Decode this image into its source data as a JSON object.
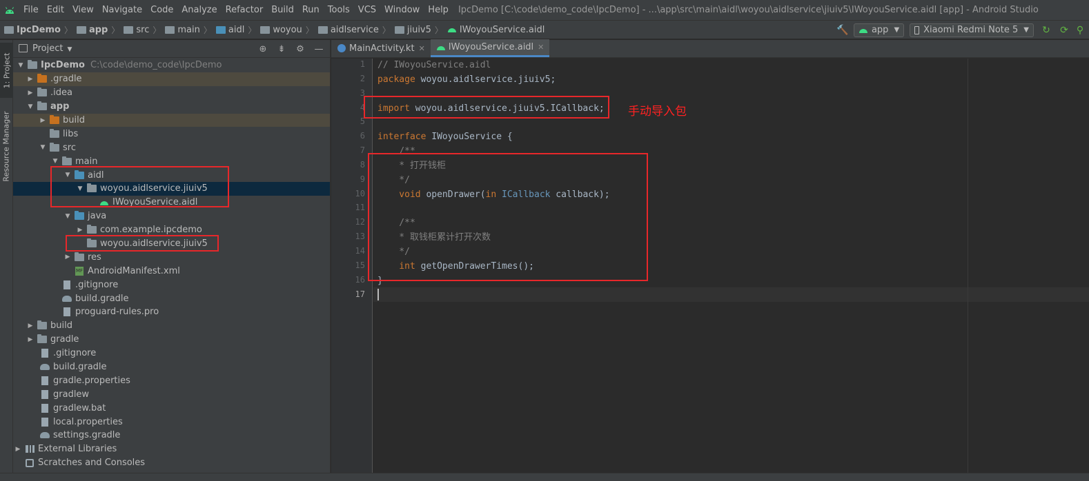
{
  "menu": {
    "items": [
      "File",
      "Edit",
      "View",
      "Navigate",
      "Code",
      "Analyze",
      "Refactor",
      "Build",
      "Run",
      "Tools",
      "VCS",
      "Window",
      "Help"
    ],
    "window_title": "IpcDemo [C:\\code\\demo_code\\IpcDemo] - ...\\app\\src\\main\\aidl\\woyou\\aidlservice\\jiuiv5\\IWoyouService.aidl [app] - Android Studio"
  },
  "breadcrumb": [
    "IpcDemo",
    "app",
    "src",
    "main",
    "aidl",
    "woyou",
    "aidlservice",
    "jiuiv5",
    "IWoyouService.aidl"
  ],
  "toolbar": {
    "run_config": "app",
    "device": "Xiaomi Redmi Note 5"
  },
  "side_stripe": {
    "project_tab": "1: Project",
    "resource_tab": "Resource Manager"
  },
  "project_panel": {
    "title": "Project",
    "tree": [
      {
        "label": "IpcDemo",
        "hint": "C:\\code\\demo_code\\IpcDemo"
      },
      {
        "label": ".gradle"
      },
      {
        "label": ".idea"
      },
      {
        "label": "app"
      },
      {
        "label": "build"
      },
      {
        "label": "libs"
      },
      {
        "label": "src"
      },
      {
        "label": "main"
      },
      {
        "label": "aidl"
      },
      {
        "label": "woyou.aidlservice.jiuiv5"
      },
      {
        "label": "IWoyouService.aidl"
      },
      {
        "label": "java"
      },
      {
        "label": "com.example.ipcdemo"
      },
      {
        "label": "woyou.aidlservice.jiuiv5"
      },
      {
        "label": "res"
      },
      {
        "label": "AndroidManifest.xml"
      },
      {
        "label": ".gitignore"
      },
      {
        "label": "build.gradle"
      },
      {
        "label": "proguard-rules.pro"
      },
      {
        "label": "build"
      },
      {
        "label": "gradle"
      },
      {
        "label": ".gitignore"
      },
      {
        "label": "build.gradle"
      },
      {
        "label": "gradle.properties"
      },
      {
        "label": "gradlew"
      },
      {
        "label": "gradlew.bat"
      },
      {
        "label": "local.properties"
      },
      {
        "label": "settings.gradle"
      },
      {
        "label": "External Libraries"
      },
      {
        "label": "Scratches and Consoles"
      }
    ]
  },
  "editor": {
    "tabs": [
      {
        "label": "MainActivity.kt"
      },
      {
        "label": "IWoyouService.aidl"
      }
    ],
    "line_numbers": [
      "1",
      "2",
      "3",
      "4",
      "5",
      "6",
      "7",
      "8",
      "9",
      "10",
      "11",
      "12",
      "13",
      "14",
      "15",
      "16",
      "17"
    ],
    "lines": [
      {
        "t1": "// IWoyouService.aidl"
      },
      {
        "t1": "package",
        "t2": " woyou.aidlservice.jiuiv5;"
      },
      {
        "t1": ""
      },
      {
        "t1": "import",
        "t2": " woyou.aidlservice.jiuiv5.ICallback;"
      },
      {
        "t1": ""
      },
      {
        "t1": "interface",
        "t2": " IWoyouService {"
      },
      {
        "t1": "    /**"
      },
      {
        "t1": "    * 打开钱柜"
      },
      {
        "t1": "    */"
      },
      {
        "t1": "    void",
        "t2": " openDrawer(",
        "t3": "in",
        "t4": " ICallback",
        "t5": " callback);"
      },
      {
        "t1": ""
      },
      {
        "t1": "    /**"
      },
      {
        "t1": "    * 取钱柜累计打开次数"
      },
      {
        "t1": "    */"
      },
      {
        "t1": "    int",
        "t2": " getOpenDrawerTimes();"
      },
      {
        "t1": "}"
      },
      {
        "t1": ""
      }
    ]
  },
  "annotation": "手动导入包",
  "colors": {
    "annotation_red": "#e8272a",
    "keyword": "#cc7832",
    "comment": "#808080",
    "text": "#a9b7c6",
    "selection": "#0d293e",
    "active_tab_underline": "#4a88c7"
  }
}
